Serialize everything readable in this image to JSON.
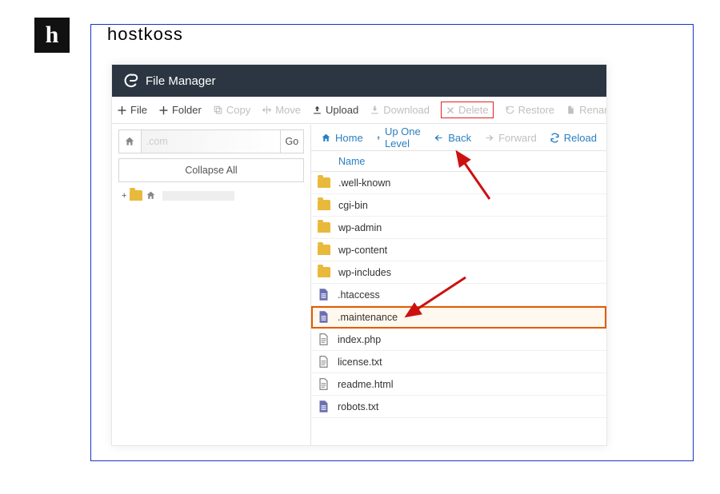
{
  "brand": {
    "logo_letter": "h",
    "name": "hostkoss"
  },
  "titlebar": {
    "label": "File Manager"
  },
  "toolbar": {
    "file": "File",
    "folder": "Folder",
    "copy": "Copy",
    "move": "Move",
    "upload": "Upload",
    "download": "Download",
    "delete": "Delete",
    "restore": "Restore",
    "rename": "Rename"
  },
  "left": {
    "domain_suffix": ".com",
    "go": "Go",
    "collapse": "Collapse All"
  },
  "navbar": {
    "home": "Home",
    "up": "Up One Level",
    "back": "Back",
    "forward": "Forward",
    "reload": "Reload"
  },
  "columns": {
    "name": "Name"
  },
  "rows": [
    {
      "type": "folder",
      "name": ".well-known"
    },
    {
      "type": "folder",
      "name": "cgi-bin"
    },
    {
      "type": "folder",
      "name": "wp-admin"
    },
    {
      "type": "folder",
      "name": "wp-content"
    },
    {
      "type": "folder",
      "name": "wp-includes"
    },
    {
      "type": "file-text",
      "name": ".htaccess"
    },
    {
      "type": "file-text",
      "name": ".maintenance",
      "highlight": true
    },
    {
      "type": "file-code",
      "name": "index.php"
    },
    {
      "type": "file-doc",
      "name": "license.txt"
    },
    {
      "type": "file-doc",
      "name": "readme.html"
    },
    {
      "type": "file-text",
      "name": "robots.txt"
    }
  ]
}
